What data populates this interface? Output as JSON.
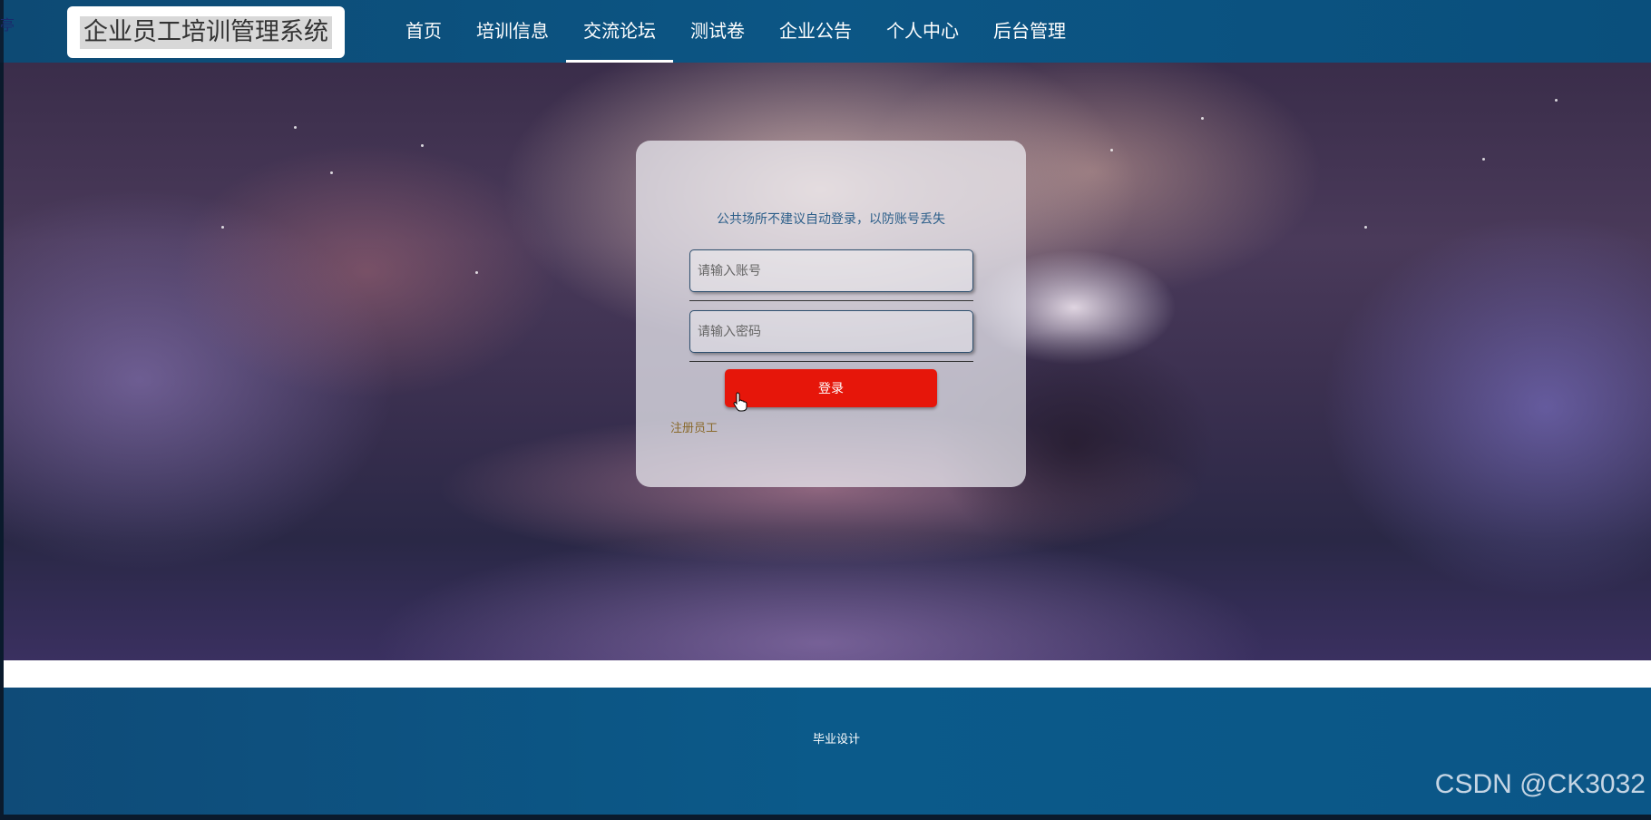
{
  "header": {
    "logo_text": "企业员工培训管理系统",
    "corner_glyph": "亭",
    "nav": [
      {
        "label": "首页",
        "active": false
      },
      {
        "label": "培训信息",
        "active": false
      },
      {
        "label": "交流论坛",
        "active": true
      },
      {
        "label": "测试卷",
        "active": false
      },
      {
        "label": "企业公告",
        "active": false
      },
      {
        "label": "个人中心",
        "active": false
      },
      {
        "label": "后台管理",
        "active": false
      }
    ]
  },
  "login": {
    "hint": "公共场所不建议自动登录，以防账号丢失",
    "account_placeholder": "请输入账号",
    "account_value": "",
    "password_placeholder": "请输入密码",
    "password_value": "",
    "submit_label": "登录",
    "register_label": "注册员工"
  },
  "footer": {
    "text": "毕业设计"
  },
  "watermark": "CSDN @CK3032",
  "colors": {
    "header_bg": "#0c5685",
    "login_button": "#e6160a",
    "register_link": "#8a6a2c",
    "hint_text": "#2d5f8a"
  },
  "icons": {
    "cursor": "hand-pointer-icon"
  }
}
